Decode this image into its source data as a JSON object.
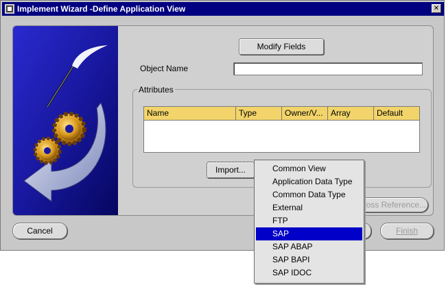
{
  "window": {
    "title": "Implement Wizard -Define Application View",
    "close_glyph": "✕"
  },
  "toolbar": {
    "modify_fields_label": "Modify Fields"
  },
  "form": {
    "object_name_label": "Object Name",
    "object_name_value": "",
    "attributes_label": "Attributes"
  },
  "table": {
    "columns": [
      "Name",
      "Type",
      "Owner/V...",
      "Array",
      "Default"
    ],
    "rows": []
  },
  "import_button_label": "Import...",
  "cross_reference_label": "Cross Reference...",
  "footer": {
    "cancel_label": "Cancel",
    "finish_label": "Finish"
  },
  "import_menu": {
    "items": [
      "Common View",
      "Application Data Type",
      "Common Data Type",
      "External",
      "FTP",
      "SAP",
      "SAP ABAP",
      "SAP BAPI",
      "SAP IDOC"
    ],
    "selected": "SAP"
  },
  "colors": {
    "title_bar": "#000080",
    "table_header": "#f2d46a",
    "menu_selection": "#0000c8",
    "art_background": "#1a1aa8"
  }
}
